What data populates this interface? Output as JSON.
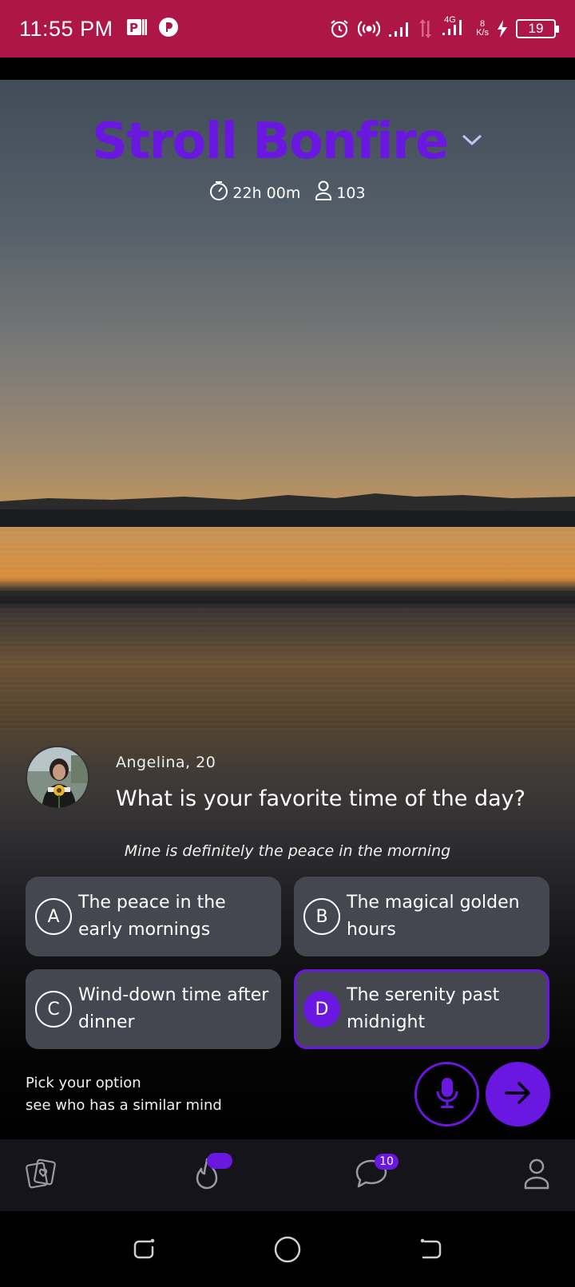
{
  "status_bar": {
    "time": "11:55 PM",
    "network_label": "4G",
    "speed_value": "8",
    "speed_unit": "K/s",
    "battery": "19"
  },
  "room": {
    "title": "Stroll Bonfire",
    "timer": "22h 00m",
    "participants": "103"
  },
  "question": {
    "asker": "Angelina, 20",
    "text": "What is your favorite time of the day?",
    "hint": "Mine is definitely the peace in the morning"
  },
  "options": [
    {
      "letter": "A",
      "text": "The peace in the early mornings"
    },
    {
      "letter": "B",
      "text": "The magical golden hours"
    },
    {
      "letter": "C",
      "text": "Wind-down time after dinner"
    },
    {
      "letter": "D",
      "text": "The serenity past midnight"
    }
  ],
  "footer": {
    "line1": "Pick your option",
    "line2": "see who has a similar mind"
  },
  "bottom_nav": {
    "chat_badge": "10"
  },
  "colors": {
    "accent": "#6a17e2",
    "status_bar": "#ad1646",
    "option_bg": "#44474f"
  }
}
